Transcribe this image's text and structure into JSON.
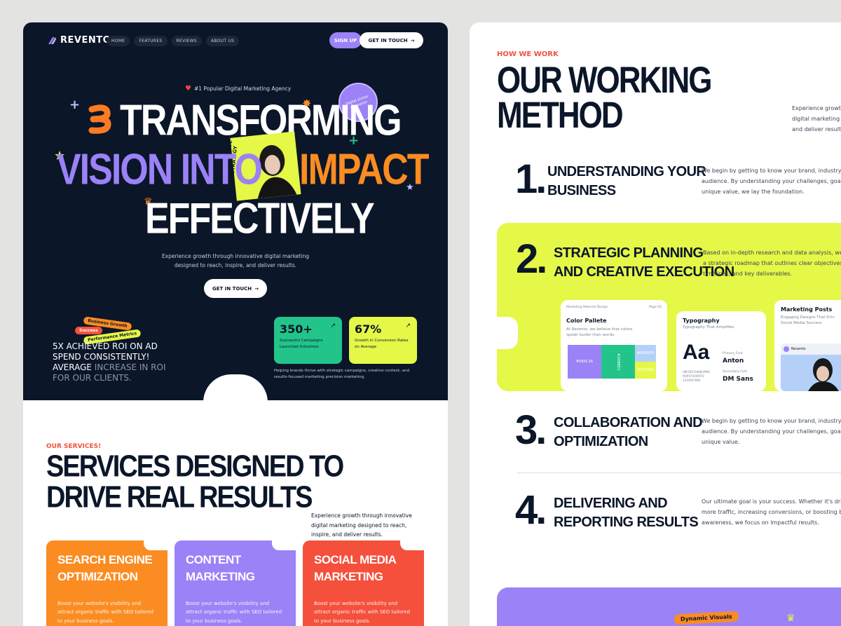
{
  "brand": {
    "name": "REVENTO"
  },
  "nav": {
    "items": [
      "HOME",
      "FEATURES",
      "REVIEWS",
      "ABOUT US"
    ]
  },
  "header": {
    "signup": "SIGN UP",
    "get_in_touch": "GET IN TOUCH"
  },
  "hero": {
    "badge": "#1 Popular Digital Marketing Agency",
    "line1": "TRANSFORMING",
    "line2a": "VISION INTO",
    "line2b": "IMPACT",
    "line3": "EFFECTIVELY",
    "sticker_vertical": "INNOVATIVE STRATEGY",
    "sticker_circle": "Digital sticker revolution",
    "subtitle": "Experience growth through innovative digital marketing designed to reach, inspire, and deliver results.",
    "cta": "GET IN TOUCH",
    "tags": [
      "Business Growth",
      "Success",
      "Performance Metrics"
    ],
    "roi_text_a": "5X ACHIEVED ROI ON AD SPEND CONSISTENTLY! AVERAGE",
    "roi_text_b": "INCREASE IN ROI FOR OUR CLIENTS.",
    "stats": [
      {
        "num": "350+",
        "label": "Successful Campaigns Launched Industries"
      },
      {
        "num": "67%",
        "label": "Growth in Conversion Rates on Average"
      }
    ],
    "stats_caption": "Helping brands thrive with strategic campaigns, creative content, and results-focused marketing precision marketing."
  },
  "services": {
    "eyebrow": "OUR SERVICES!",
    "title_1": "SERVICES DESIGNED TO",
    "title_2": "DRIVE REAL RESULTS",
    "desc": "Experience growth through innovative digital marketing designed to reach, inspire, and deliver results.",
    "cards": [
      {
        "title": "SEARCH ENGINE OPTIMIZATION",
        "desc": "Boost your website's visibility and attract organic traffic with SEO tailored to your business goals.",
        "color": "#fb8c22"
      },
      {
        "title": "CONTENT MARKETING",
        "desc": "Boost your website's visibility and attract organic traffic with SEO tailored to your business goals.",
        "color": "#9b82f7"
      },
      {
        "title": "SOCIAL MEDIA MARKETING",
        "desc": "Boost your website's visibility and attract organic traffic with SEO tailored to your business goals.",
        "color": "#f4503c"
      }
    ]
  },
  "method": {
    "eyebrow": "HOW WE WORK",
    "title_1": "OUR WORKING",
    "title_2": "METHOD",
    "desc": "Experience growt digital marketing and deliver result",
    "steps": [
      {
        "num": "1.",
        "title_1": "UNDERSTANDING YOUR",
        "title_2": "BUSINESS",
        "desc": "We begin by getting to know your brand, industry, audience. By understanding your challenges, goals unique value, we lay the foundation."
      },
      {
        "num": "2.",
        "title_1": "STRATEGIC PLANNING",
        "title_2": "AND CREATIVE EXECUTION",
        "desc": "Based on in-depth research and data analysis, we a strategic roadmap that outlines clear objectives timelines, and key deliverables."
      },
      {
        "num": "3.",
        "title_1": "COLLABORATION AND",
        "title_2": "OPTIMIZATION",
        "desc": "We begin by getting to know your brand, industry, audience. By understanding your challenges, goals unique value."
      },
      {
        "num": "4.",
        "title_1": "DELIVERING AND",
        "title_2": "REPORTING RESULTS",
        "desc": "Our ultimate goal is your success. Whether it's driv more traffic, increasing conversions, or boosting b awareness, we focus on impactful results."
      }
    ],
    "brand_card": {
      "label": "Marketing Material Design",
      "page": "Page 05",
      "title": "Color Pallete",
      "text": "At Revento, we believe that colors speak louder than words.",
      "swatches": [
        "#560C3A",
        "#B4D0F8",
        "#DFF26B",
        "#2DB8E3"
      ]
    },
    "type_card": {
      "title": "Typography",
      "sub": "Typography That Amplifies",
      "big": "Aa",
      "alphabet": "ABCDEFGHIJKLMNO PQRSTUVWXYZ 1234567890",
      "primary_label": "Primary Font",
      "primary": "Anton",
      "secondary_label": "Secondary Font",
      "secondary": "DM Sans"
    },
    "posts_card": {
      "title": "Marketing Posts",
      "sub": "Engaging Designs That Driv Social Media Success",
      "brand": "Revento"
    },
    "bottom_pill": "Dynamic Visuals"
  },
  "colors": {
    "navy": "#0b1629",
    "lime": "#e5f747",
    "purple": "#9b82f7",
    "orange": "#fb8c22",
    "red": "#f4503c"
  }
}
